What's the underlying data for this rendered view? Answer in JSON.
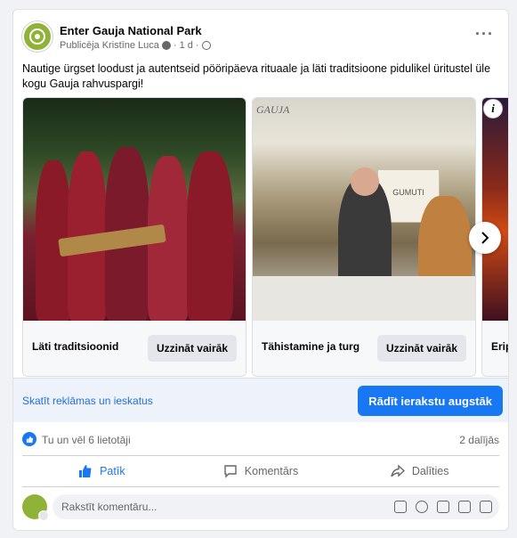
{
  "post": {
    "page_name": "Enter Gauja National Park",
    "published_by": "Publicēja Kristīne Luca",
    "time": "1 d",
    "caption": "Nautige ürgset loodust ja autentseid pööripäeva rituaale ja läti traditsioone pidulikel üritustel üle kogu Gauja rahvuspargi!"
  },
  "carousel": {
    "slides": [
      {
        "title": "Läti traditsioonid",
        "cta": "Uzzināt vairāk"
      },
      {
        "title": "Tähistamine ja turg",
        "cta": "Uzzināt vairāk"
      },
      {
        "title": "Eripa"
      }
    ],
    "image_text": "GAUJA",
    "sign_text": "GUMUTI"
  },
  "adbar": {
    "link": "Skatīt reklāmas un ieskatus",
    "boost": "Rādīt ierakstu augstāk"
  },
  "stats": {
    "likes": "Tu un vēl 6 lietotāji",
    "shares": "2 dalījās"
  },
  "actions": {
    "like": "Patīk",
    "comment": "Komentārs",
    "share": "Dalīties"
  },
  "comment": {
    "placeholder": "Rakstīt komentāru..."
  },
  "colors": {
    "brand_blue": "#1877f2",
    "page_avatar_green": "#8fb339"
  }
}
